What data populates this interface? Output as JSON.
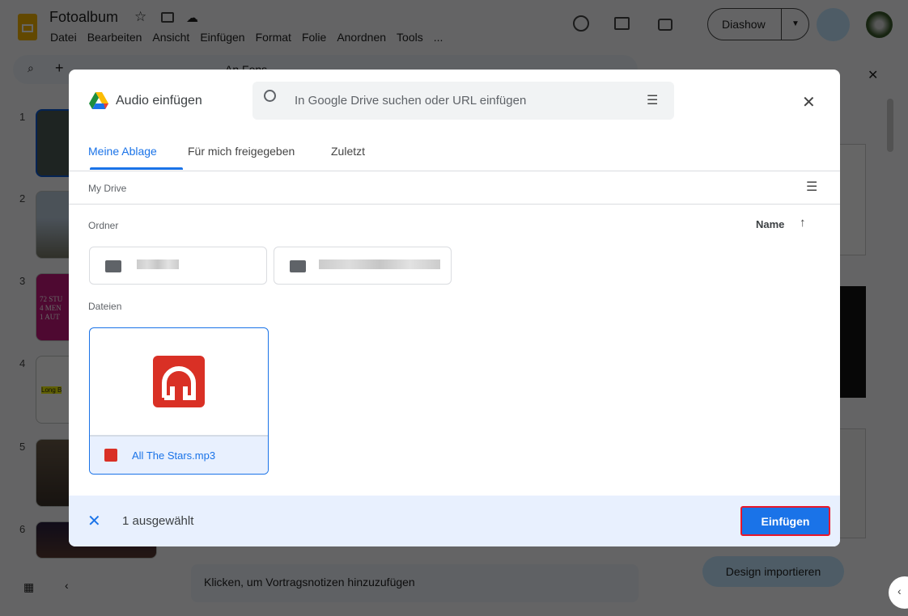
{
  "app": {
    "title": "Fotoalbum",
    "menu": [
      "Datei",
      "Bearbeiten",
      "Ansicht",
      "Einfügen",
      "Format",
      "Folie",
      "Anordnen",
      "Tools",
      "..."
    ],
    "slideshow_label": "Diashow",
    "font_label": "An Fens",
    "notes_placeholder": "Klicken, um Vortragsnotizen hinzuzufügen",
    "import_theme_label": "Design importieren",
    "slide_numbers": [
      "1",
      "2",
      "3",
      "4",
      "5",
      "6"
    ],
    "slide3_text": "72 STU\n4 MEN\n1 AUT",
    "slide4_text": "Long B"
  },
  "dialog": {
    "title": "Audio einfügen",
    "search_placeholder": "In Google Drive suchen oder URL einfügen",
    "tabs": [
      {
        "label": "Meine Ablage",
        "active": true
      },
      {
        "label": "Für mich freigegeben"
      },
      {
        "label": "Zuletzt"
      }
    ],
    "breadcrumb": "My Drive",
    "folders_label": "Ordner",
    "sort_label": "Name",
    "files_label": "Dateien",
    "files": [
      {
        "name": "All The Stars.mp3",
        "selected": true
      }
    ],
    "selection_text": "1 ausgewählt",
    "insert_label": "Einfügen"
  },
  "colors": {
    "accent": "#1a73e8",
    "audio_icon": "#d93025",
    "selection_bg": "#e8f0fe"
  }
}
